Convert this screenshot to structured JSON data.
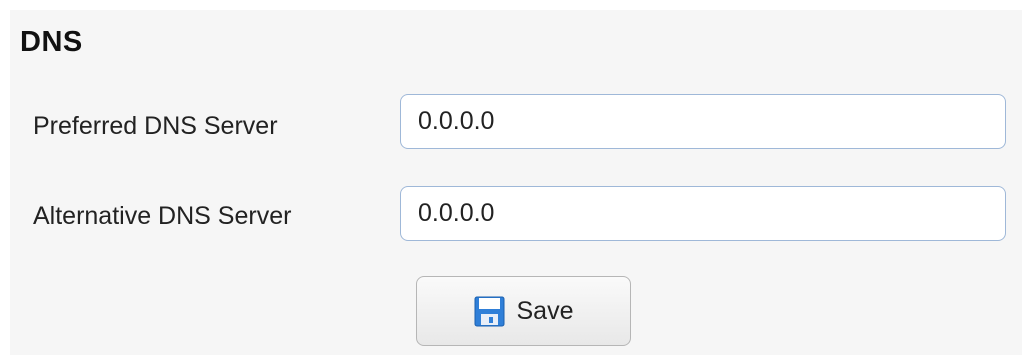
{
  "section": {
    "title": "DNS"
  },
  "fields": {
    "preferred": {
      "label": "Preferred DNS Server",
      "value": "0.0.0.0"
    },
    "alternative": {
      "label": "Alternative DNS Server",
      "value": "0.0.0.0"
    }
  },
  "actions": {
    "save_label": "Save",
    "save_icon": "floppy-disk-icon"
  },
  "colors": {
    "panel_background": "#f6f6f6",
    "input_border": "#9fb8d8",
    "save_icon_blue": "#2f7fd8"
  }
}
